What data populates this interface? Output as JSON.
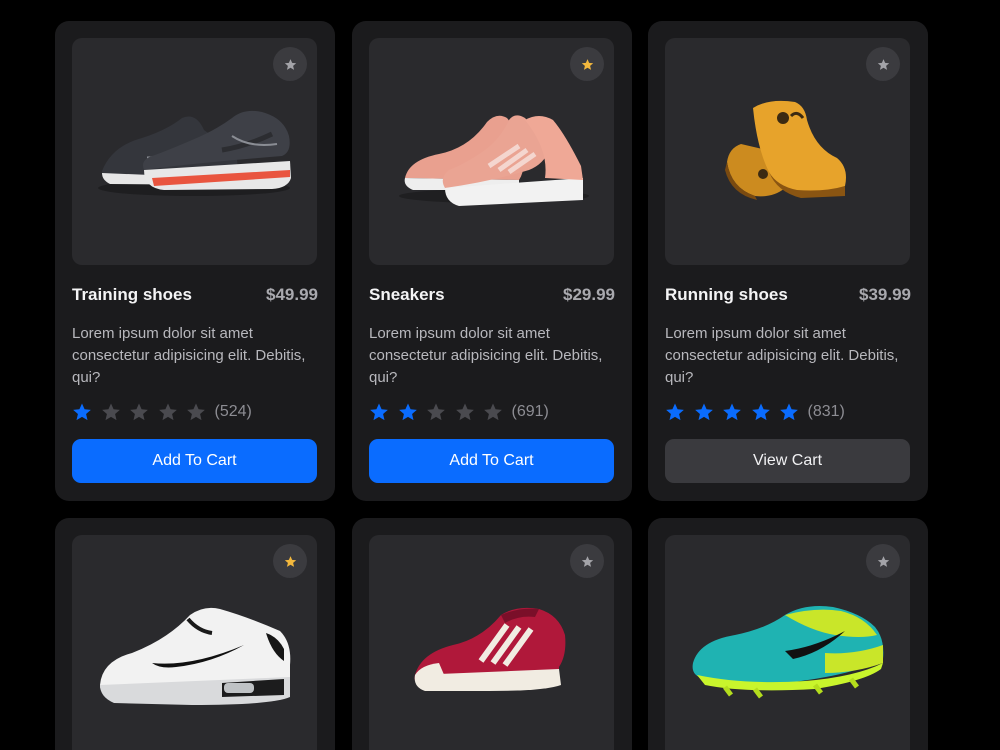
{
  "colors": {
    "background": "#000000",
    "card": "#1b1b1d",
    "image_bg": "#2a2a2d",
    "accent": "#0a6cff",
    "star_filled": "#0a6cff",
    "star_empty": "#4a4a4f",
    "favorite_active": "#f3b83d",
    "favorite_inactive": "#a3a3a8"
  },
  "products": [
    {
      "name": "Training shoes",
      "price": "$49.99",
      "description": "Lorem ipsum dolor sit amet consectetur adipisicing elit. Debitis, qui?",
      "rating": 1,
      "reviews": "(524)",
      "favorite": false,
      "button": "Add To Cart",
      "button_style": "primary",
      "image_icon": "dark-running-shoe"
    },
    {
      "name": "Sneakers",
      "price": "$29.99",
      "description": "Lorem ipsum dolor sit amet consectetur adipisicing elit. Debitis, qui?",
      "rating": 2,
      "reviews": "(691)",
      "favorite": true,
      "button": "Add To Cart",
      "button_style": "primary",
      "image_icon": "pink-knit-sneaker"
    },
    {
      "name": "Running shoes",
      "price": "$39.99",
      "description": "Lorem ipsum dolor sit amet consectetur adipisicing elit. Debitis, qui?",
      "rating": 5,
      "reviews": "(831)",
      "favorite": false,
      "button": "View Cart",
      "button_style": "secondary",
      "image_icon": "yellow-high-top-sneaker"
    },
    {
      "favorite": true,
      "image_icon": "white-air-max-sneaker"
    },
    {
      "favorite": false,
      "image_icon": "red-striped-sneaker"
    },
    {
      "favorite": false,
      "image_icon": "teal-football-boot"
    }
  ]
}
